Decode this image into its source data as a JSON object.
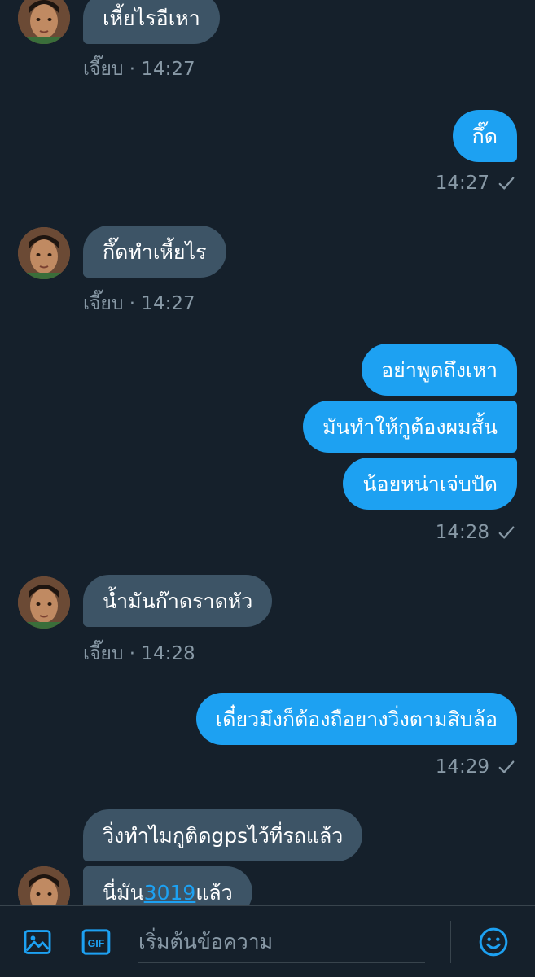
{
  "messages": [
    {
      "side": "in",
      "text": "เหี้ยไรอีเหา",
      "meta": "เจี๊ยบ · 14:27"
    },
    {
      "side": "out",
      "text": "กึ๊ด",
      "meta": "14:27"
    },
    {
      "side": "in",
      "text": "กึ๊ดทำเหี้ยไร",
      "meta": "เจี๊ยบ · 14:27"
    },
    {
      "side": "out",
      "text": "อย่าพูดถึงเหา"
    },
    {
      "side": "out",
      "text": "มันทำให้กูต้องผมสั้น"
    },
    {
      "side": "out",
      "text": "น้อยหน่าเจ่บปัด",
      "meta": "14:28"
    },
    {
      "side": "in",
      "text": "น้ำมันก๊าดราดหัว",
      "meta": "เจี๊ยบ · 14:28"
    },
    {
      "side": "out",
      "text": "เดี๋ยวมึงก็ต้องถือยางวิ่งตามสิบล้อ",
      "meta": "14:29"
    },
    {
      "side": "in",
      "text": "วิ่งทำไมกูติดgpsไว้ที่รถแล้ว"
    },
    {
      "side": "in",
      "text_before": "นี่มัน",
      "link": "3019",
      "text_after": "แล้ว"
    }
  ],
  "composer": {
    "placeholder": "เริ่มต้นข้อความ",
    "gif_label": "GIF"
  },
  "icons": {
    "image": "image-icon",
    "gif": "gif-icon",
    "emoji": "emoji-icon",
    "check": "check-icon"
  },
  "colors": {
    "background": "#15202b",
    "incoming_bubble": "#3d5466",
    "outgoing_bubble": "#1da1f2",
    "meta_text": "#8899a6",
    "accent": "#1da1f2"
  }
}
